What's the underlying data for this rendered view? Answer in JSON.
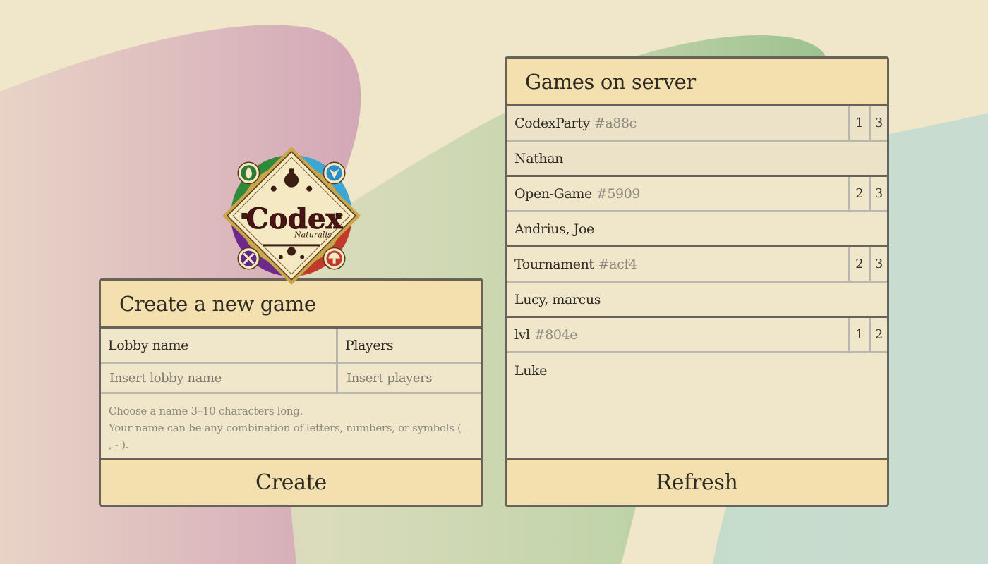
{
  "create": {
    "title": "Create a new game",
    "lobby_label": "Lobby name",
    "players_label": "Players",
    "lobby_placeholder": "Insert lobby name",
    "players_placeholder": "Insert players",
    "hint_line1": "Choose a name 3–10 characters long.",
    "hint_line2": "Your name can be any combination of letters, numbers, or symbols ( _ , - ).",
    "button": "Create"
  },
  "games": {
    "title": "Games on server",
    "refresh": "Refresh",
    "list": [
      {
        "name": "CodexParty",
        "id": "#a88c",
        "current": "1",
        "max": "3",
        "players": "Nathan",
        "selected": true
      },
      {
        "name": "Open-Game",
        "id": "#5909",
        "current": "2",
        "max": "3",
        "players": "Andrius, Joe",
        "selected": false
      },
      {
        "name": "Tournament",
        "id": "#acf4",
        "current": "2",
        "max": "3",
        "players": "Lucy, marcus",
        "selected": false
      },
      {
        "name": "lvl",
        "id": "#804e",
        "current": "1",
        "max": "2",
        "players": "Luke",
        "selected": false
      }
    ]
  },
  "logo": {
    "text": "Codex",
    "subtext": "Naturalis"
  },
  "colors": {
    "panel_bg": "#f0e6c9",
    "header_bg": "#f3e0ae",
    "border": "#67625a",
    "divider": "#b9b6ad",
    "blob_pink": "#d5a7b6",
    "blob_green": "#9cc190",
    "blob_teal": "#c4dccd"
  }
}
